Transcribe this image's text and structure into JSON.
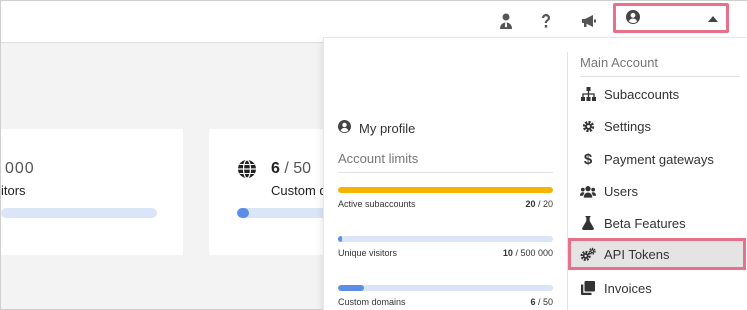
{
  "topbar": {
    "icons": [
      "user-tie-icon",
      "question-icon",
      "megaphone-icon"
    ],
    "account_button_icon": "user-circle-icon"
  },
  "cards": [
    {
      "value": "000",
      "label": "itors"
    },
    {
      "value_current": "6",
      "value_sep": "/ 50",
      "label": "Custom d",
      "icon": "globe-icon",
      "progress": 0.12
    }
  ],
  "dropdown": {
    "profile_label": "My profile",
    "limits_title": "Account limits",
    "limits": [
      {
        "label": "Active subaccounts",
        "used": "20",
        "total": "/ 20",
        "fraction": 1.0,
        "color": "#f4b400"
      },
      {
        "label": "Unique visitors",
        "used": "10",
        "total": "/ 500 000",
        "fraction": 0.02,
        "color": "#5b8ee6"
      },
      {
        "label": "Custom domains",
        "used": "6",
        "total": "/ 50",
        "fraction": 0.12,
        "color": "#5b8ee6"
      }
    ],
    "menu_title": "Main Account",
    "menu": [
      {
        "label": "Subaccounts",
        "icon": "sitemap-icon"
      },
      {
        "label": "Settings",
        "icon": "gear-icon"
      },
      {
        "label": "Payment gateways",
        "icon": "dollar-icon"
      },
      {
        "label": "Users",
        "icon": "users-icon"
      },
      {
        "label": "Beta Features",
        "icon": "flask-icon"
      },
      {
        "label": "API Tokens",
        "icon": "gears-icon",
        "active": true
      },
      {
        "label": "Invoices",
        "icon": "copy-icon"
      }
    ]
  },
  "colors": {
    "highlight_border": "#e8708a",
    "bar_blue": "#5b8ee6",
    "bar_track": "#dbe5f8",
    "bar_yellow": "#f4b400"
  }
}
